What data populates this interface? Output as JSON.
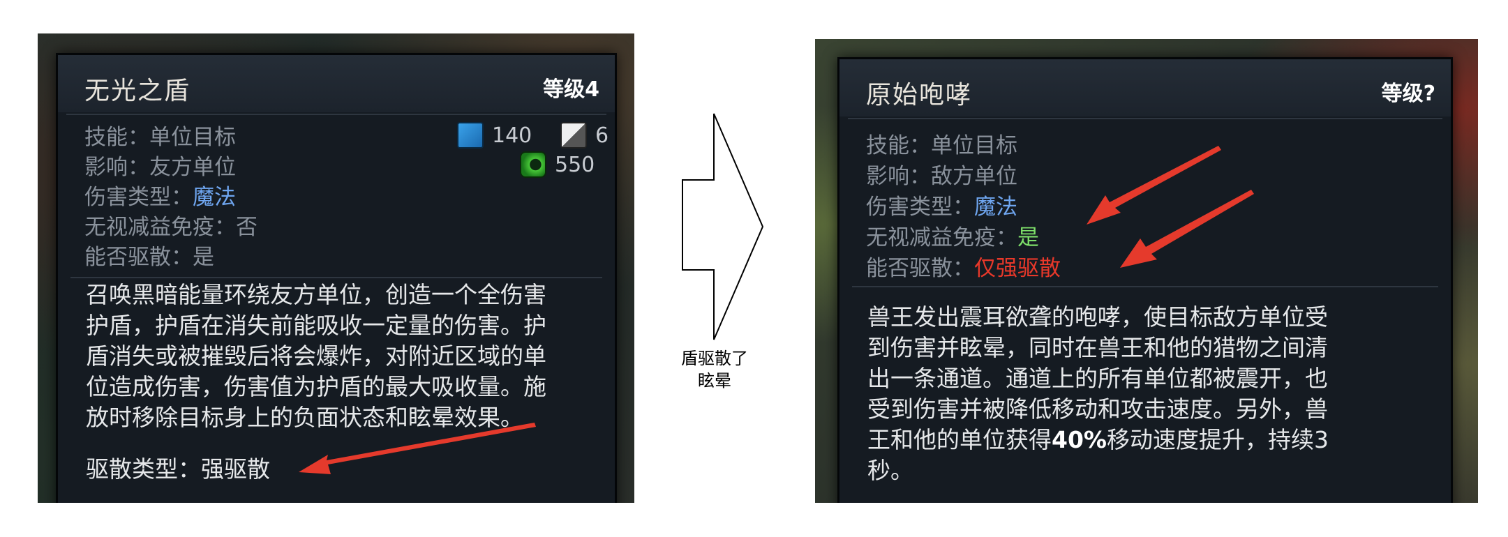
{
  "left_tooltip": {
    "ability_name": "无光之盾",
    "level": "等级4",
    "mana_cost": "140",
    "cooldown": "6",
    "cast_range": "550",
    "attributes": [
      {
        "label": "技能：",
        "value": "单位目标"
      },
      {
        "label": "影响：",
        "value": "友方单位"
      },
      {
        "label": "伤害类型：",
        "value": "魔法"
      },
      {
        "label": "无视减益免疫：",
        "value": "否"
      },
      {
        "label": "能否驱散：",
        "value": "是"
      }
    ],
    "description_lines": [
      "召唤黑暗能量环绕友方单位，创造一个全伤害",
      "护盾，护盾在消失前能吸收一定量的伤害。护",
      "盾消失或被摧毁后将会爆炸，对附近区域的单",
      "位造成伤害，伤害值为护盾的最大吸收量。施",
      "放时移除目标身上的负面状态和眩晕效果。"
    ],
    "dispel_type": "驱散类型：强驱散"
  },
  "middle": {
    "label_line1": "盾驱散了",
    "label_line2": "眩晕"
  },
  "right_tooltip": {
    "ability_name": "原始咆哮",
    "level": "等级?",
    "attributes": [
      {
        "label": "技能：",
        "value": "单位目标"
      },
      {
        "label": "影响：",
        "value": "敌方单位"
      },
      {
        "label": "伤害类型：",
        "value": "魔法"
      },
      {
        "label": "无视减益免疫：",
        "value": "是"
      },
      {
        "label": "能否驱散：",
        "value": "仅强驱散"
      }
    ],
    "description_lines": [
      "兽王发出震耳欲聋的咆哮，使目标敌方单位受",
      "到伤害并眩晕，同时在兽王和他的猎物之间清",
      "出一条通道。通道上的所有单位都被震开，也",
      "受到伤害并被降低移动和攻击速度。另外，兽"
    ],
    "desc_line5_pre": "王和他的单位获得",
    "desc_line5_bold": "40%",
    "desc_line5_post": "移动速度提升，持续3",
    "desc_line6": "秒。"
  },
  "colors": {
    "magic_blue": "#6fa6f0",
    "yes_green": "#7ee06a",
    "strong_dispel_red": "#e8382a",
    "arrow_red": "#e53a2c"
  },
  "icons": [
    "mana-icon",
    "cooldown-icon",
    "cast-range-icon",
    "annotation-arrow",
    "hollow-right-arrow"
  ]
}
